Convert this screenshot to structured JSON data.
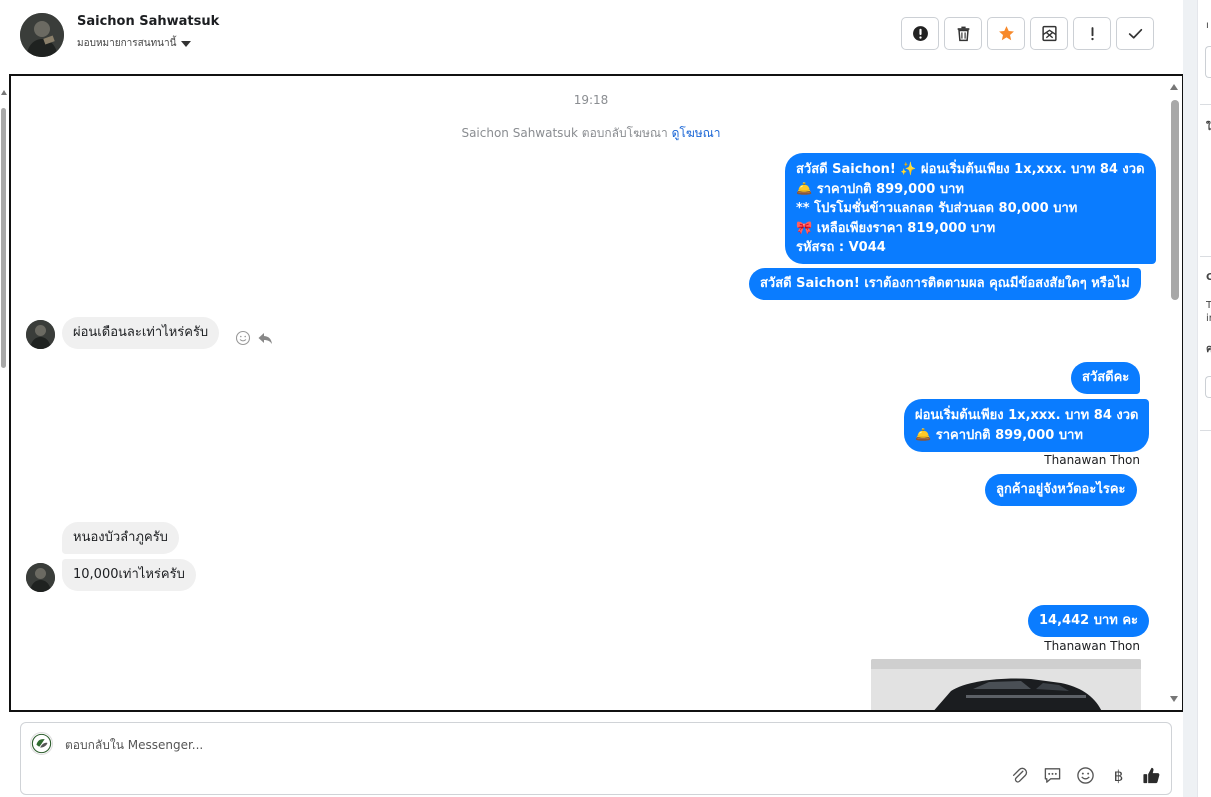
{
  "header": {
    "contact_name": "Saichon Sahwatsuk",
    "assign_label": "มอบหมายการสนทนานี้",
    "actions": [
      {
        "name": "spam-button",
        "icon": "alert-circle-icon"
      },
      {
        "name": "delete-button",
        "icon": "trash-icon"
      },
      {
        "name": "star-button",
        "icon": "star-icon"
      },
      {
        "name": "mark-unread-button",
        "icon": "envelope-x-icon"
      },
      {
        "name": "follow-up-button",
        "icon": "exclamation-icon"
      },
      {
        "name": "done-button",
        "icon": "check-icon"
      }
    ]
  },
  "thread": {
    "time": "19:18",
    "ad_note": "Saichon Sahwatsuk ตอบกลับโฆษณา",
    "ad_link": "ดูโฆษณา",
    "messages": {
      "m1_l1": "สวัสดี Saichon! ✨  ผ่อนเริ่มต้นเพียง 1x,xxx. บาท 84 งวด",
      "m1_l2": "🛎️ ราคาปกติ 899,000 บาท",
      "m1_l3": "** โปรโมชั่นข้าวแลกลด รับส่วนลด 80,000 บาท",
      "m1_l4": "🎀  เหลือเพียงราคา 819,000 บาท",
      "m1_l5": " รหัสรถ : V044",
      "m2": "สวัสดี Saichon! เราต้องการติดตามผล คุณมีข้อสงสัยใดๆ หรือไม่",
      "m3": "ผ่อนเดือนละเท่าไหร่ครับ",
      "m4": "สวัสดีคะ",
      "m5_l1": "ผ่อนเริ่มต้นเพียง 1x,xxx. บาท 84 งวด",
      "m5_l2": "🛎️ ราคาปกติ 899,000 บาท",
      "m6": "ลูกค้าอยู่จังหวัดอะไรคะ",
      "m7": "หนองบัวลำภูครับ",
      "m8": "10,000เท่าไหร่ครับ",
      "m9": "14,442 บาท คะ"
    },
    "sender_1": "Thanawan Thon",
    "sender_2": "Thanawan Thon"
  },
  "composer": {
    "placeholder": "ตอบกลับใน Messenger...",
    "baht_symbol": "฿",
    "tools": [
      "paperclip-icon",
      "saved-reply-icon",
      "emoji-icon",
      "baht-icon",
      "thumbs-up-icon"
    ]
  },
  "right_panel": {
    "snippets": [
      "ı",
      "ใ",
      "C",
      "T",
      "ir",
      "ค"
    ]
  },
  "colors": {
    "outgoing_bubble": "#0a7cff",
    "incoming_bubble": "#f0f0f0",
    "star": "#f7892b",
    "link": "#1a66d6"
  }
}
